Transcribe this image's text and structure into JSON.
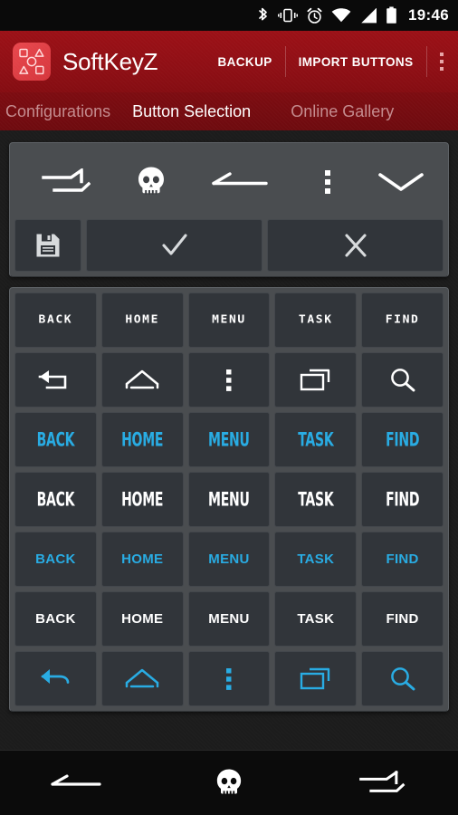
{
  "statusbar": {
    "time": "19:46",
    "icons": [
      "bluetooth-icon",
      "vibrate-icon",
      "alarm-icon",
      "wifi-icon",
      "signal-icon",
      "battery-icon"
    ]
  },
  "appbar": {
    "logo_icon": "softkeyz-logo-icon",
    "title": "SoftKeyZ",
    "backup_label": "BACKUP",
    "import_label": "IMPORT BUTTONS",
    "overflow_icon": "overflow-menu-icon",
    "brand_color": "#8f0f15"
  },
  "tabs": [
    {
      "label": "ved Configurations",
      "active": false
    },
    {
      "label": "Button Selection",
      "active": true
    },
    {
      "label": "Online Gallery",
      "active": false
    }
  ],
  "preview": {
    "keys": [
      {
        "icon": "task-angular-icon"
      },
      {
        "icon": "skull-icon"
      },
      {
        "icon": "back-flat-icon"
      },
      {
        "icon": "menu-dots-icon"
      },
      {
        "icon": "chevron-down-icon"
      }
    ],
    "actions": [
      {
        "icon": "save-floppy-icon",
        "name": "save-button"
      },
      {
        "icon": "check-icon",
        "name": "confirm-button"
      },
      {
        "icon": "close-x-icon",
        "name": "cancel-button"
      }
    ]
  },
  "grid": {
    "accent_cyan": "#29ACE3",
    "accent_white": "#FFFFFF",
    "rows": [
      {
        "style": "pixel",
        "color": "white",
        "kind": "text",
        "cells": [
          "BACK",
          "HOME",
          "MENU",
          "TASK",
          "FIND"
        ]
      },
      {
        "style": "icon",
        "color": "white",
        "kind": "icon",
        "cells": [
          "back-angular-icon",
          "home-house-icon",
          "menu-dots-icon",
          "recents-stack-icon",
          "search-icon"
        ]
      },
      {
        "style": "stencil",
        "color": "cyan",
        "kind": "text",
        "cells": [
          "BACK",
          "HOME",
          "MENU",
          "TASK",
          "FIND"
        ]
      },
      {
        "style": "stencil",
        "color": "white",
        "kind": "text",
        "cells": [
          "BACK",
          "HOME",
          "MENU",
          "TASK",
          "FIND"
        ]
      },
      {
        "style": "sans",
        "color": "cyan",
        "kind": "text",
        "cells": [
          "BACK",
          "HOME",
          "MENU",
          "TASK",
          "FIND"
        ]
      },
      {
        "style": "sans",
        "color": "white",
        "kind": "text",
        "cells": [
          "BACK",
          "HOME",
          "MENU",
          "TASK",
          "FIND"
        ]
      },
      {
        "style": "icon",
        "color": "cyan",
        "kind": "icon",
        "cells": [
          "back-curved-icon",
          "home-house-icon",
          "menu-dots-icon",
          "recents-stack-icon",
          "search-icon"
        ]
      }
    ]
  },
  "navbar": {
    "buttons": [
      {
        "icon": "back-flat-icon",
        "name": "nav-back-button"
      },
      {
        "icon": "skull-icon",
        "name": "nav-home-button"
      },
      {
        "icon": "task-angular-icon",
        "name": "nav-recents-button"
      }
    ]
  }
}
